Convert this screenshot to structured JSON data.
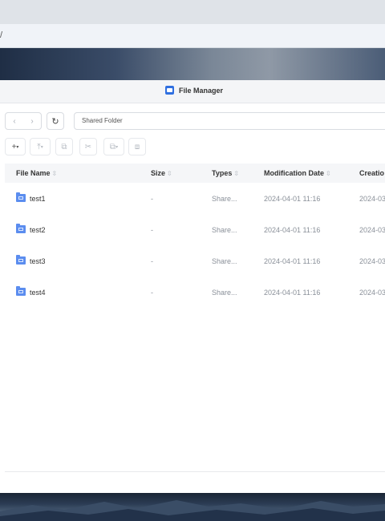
{
  "browser": {
    "url_fragment": "/"
  },
  "window": {
    "title": "File Manager"
  },
  "nav": {
    "back_icon": "chevron-left-icon",
    "forward_icon": "chevron-right-icon",
    "refresh_icon": "refresh-icon",
    "back_glyph": "‹",
    "forward_glyph": "›",
    "refresh_glyph": "↻",
    "path": "Shared Folder"
  },
  "toolbar": {
    "new_glyph": "+",
    "upload_glyph": "⤒",
    "copy_glyph": "⧉",
    "cut_glyph": "✂",
    "paste_glyph": "⧉",
    "more_glyph": "⧈",
    "caret": "▾"
  },
  "table": {
    "columns": [
      {
        "label": "File Name"
      },
      {
        "label": "Size"
      },
      {
        "label": "Types"
      },
      {
        "label": "Modification Date"
      },
      {
        "label": "Creatio"
      }
    ],
    "sort_glyph": "⇳",
    "rows": [
      {
        "name": "test1",
        "size": "-",
        "type": "Share...",
        "modified": "2024-04-01 11:16",
        "created": "2024-03"
      },
      {
        "name": "test2",
        "size": "-",
        "type": "Share...",
        "modified": "2024-04-01 11:16",
        "created": "2024-03"
      },
      {
        "name": "test3",
        "size": "-",
        "type": "Share...",
        "modified": "2024-04-01 11:16",
        "created": "2024-03"
      },
      {
        "name": "test4",
        "size": "-",
        "type": "Share...",
        "modified": "2024-04-01 11:16",
        "created": "2024-03"
      }
    ]
  },
  "colors": {
    "accent": "#2f6fe0",
    "folder": "#5b8def"
  }
}
